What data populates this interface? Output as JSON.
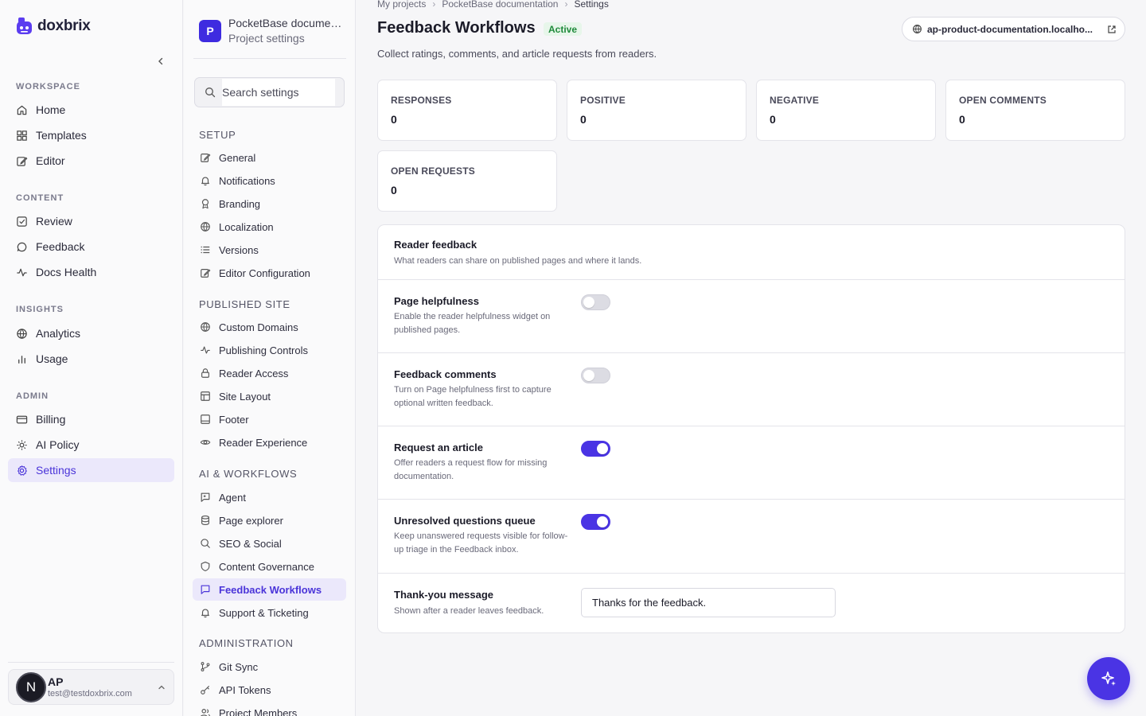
{
  "brand": {
    "name": "doxbrix"
  },
  "nav": {
    "sections": {
      "workspace": "WORKSPACE",
      "content": "CONTENT",
      "insights": "INSIGHTS",
      "admin": "ADMIN"
    },
    "items": {
      "home": "Home",
      "templates": "Templates",
      "editor": "Editor",
      "review": "Review",
      "feedback": "Feedback",
      "docs_health": "Docs Health",
      "analytics": "Analytics",
      "usage": "Usage",
      "billing": "Billing",
      "ai_policy": "AI Policy",
      "settings": "Settings"
    },
    "active": "Settings"
  },
  "account": {
    "initial": "N",
    "name": "AP",
    "email": "test@testdoxbrix.com"
  },
  "project": {
    "badge": "P",
    "name": "PocketBase documen...",
    "subtitle": "Project settings"
  },
  "settings_nav": {
    "search_placeholder": "Search settings",
    "sections": {
      "setup": "SETUP",
      "published_site": "PUBLISHED SITE",
      "ai_workflows": "AI & WORKFLOWS",
      "administration": "ADMINISTRATION"
    },
    "items": {
      "general": "General",
      "notifications": "Notifications",
      "branding": "Branding",
      "localization": "Localization",
      "versions": "Versions",
      "editor_configuration": "Editor Configuration",
      "custom_domains": "Custom Domains",
      "publishing_controls": "Publishing Controls",
      "reader_access": "Reader Access",
      "site_layout": "Site Layout",
      "footer": "Footer",
      "reader_experience": "Reader Experience",
      "agent": "Agent",
      "page_explorer": "Page explorer",
      "seo_social": "SEO & Social",
      "content_governance": "Content Governance",
      "feedback_workflows": "Feedback Workflows",
      "support_ticketing": "Support & Ticketing",
      "git_sync": "Git Sync",
      "api_tokens": "API Tokens",
      "project_members": "Project Members"
    }
  },
  "breadcrumb": {
    "root": "My projects",
    "project": "PocketBase documentation",
    "current": "Settings"
  },
  "page": {
    "title": "Feedback Workflows",
    "status": "Active",
    "subtitle": "Collect ratings, comments, and article requests from readers.",
    "domain": "ap-product-documentation.localho..."
  },
  "stats": {
    "responses": {
      "label": "RESPONSES",
      "value": "0"
    },
    "positive": {
      "label": "POSITIVE",
      "value": "0"
    },
    "negative": {
      "label": "NEGATIVE",
      "value": "0"
    },
    "open_comments": {
      "label": "OPEN COMMENTS",
      "value": "0"
    },
    "open_requests": {
      "label": "OPEN REQUESTS",
      "value": "0"
    }
  },
  "reader_feedback": {
    "title": "Reader feedback",
    "subtitle": "What readers can share on published pages and where it lands.",
    "rows": {
      "page_helpfulness": {
        "title": "Page helpfulness",
        "desc": "Enable the reader helpfulness widget on published pages.",
        "enabled": false
      },
      "feedback_comments": {
        "title": "Feedback comments",
        "desc": "Turn on Page helpfulness first to capture optional written feedback.",
        "enabled": false
      },
      "request_article": {
        "title": "Request an article",
        "desc": "Offer readers a request flow for missing documentation.",
        "enabled": true
      },
      "unresolved_queue": {
        "title": "Unresolved questions queue",
        "desc": "Keep unanswered requests visible for follow-up triage in the Feedback inbox.",
        "enabled": true
      },
      "thank_you": {
        "title": "Thank-you message",
        "desc": "Shown after a reader leaves feedback.",
        "value": "Thanks for the feedback."
      }
    }
  },
  "colors": {
    "accent": "#4a34e4",
    "active_bg": "#ebe8fb",
    "status_green": "#1f8a3b"
  },
  "icons": {
    "fab": "sparkles-icon"
  }
}
